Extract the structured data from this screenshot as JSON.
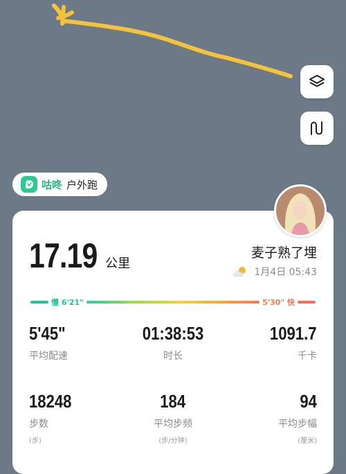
{
  "brand": {
    "name": "咕咚",
    "activity_type": "户外跑",
    "color": "#1fb97a"
  },
  "map": {
    "route_color": "#f5c33b",
    "background": "#6c7a88",
    "layers_icon": "layers-icon",
    "route_icon": "route-icon"
  },
  "summary": {
    "distance_value": "17.19",
    "distance_unit": "公里",
    "user_name": "麦子熟了埋",
    "date": "1月4日 05:43",
    "weather_icon": "partly-cloudy-icon"
  },
  "pace_bar": {
    "slow_label": "慢 6'21\"",
    "fast_label": "5'30\" 快",
    "slow_color": "#1fc49a",
    "fast_color": "#f0705e"
  },
  "stats": [
    {
      "value": "5'45\"",
      "label": "平均配速",
      "unit": ""
    },
    {
      "value": "01:38:53",
      "label": "时长",
      "unit": ""
    },
    {
      "value": "1091.7",
      "label": "千卡",
      "unit": ""
    },
    {
      "value": "18248",
      "label": "步数",
      "unit": "(步)"
    },
    {
      "value": "184",
      "label": "平均步频",
      "unit": "(步/分钟)"
    },
    {
      "value": "94",
      "label": "平均步幅",
      "unit": "(厘米)"
    }
  ]
}
